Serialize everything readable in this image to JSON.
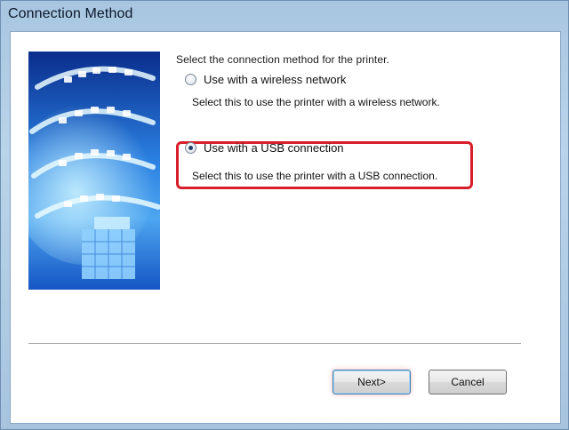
{
  "window": {
    "title": "Connection Method"
  },
  "prompt": "Select the connection method for the printer.",
  "options": [
    {
      "label": "Use with a wireless network",
      "description": "Select this to use the printer with a wireless network.",
      "selected": false
    },
    {
      "label": "Use with a USB connection",
      "description": "Select this to use the printer with a USB connection.",
      "selected": true
    }
  ],
  "buttons": {
    "next": "Next>",
    "cancel": "Cancel"
  },
  "colors": {
    "highlight": "#d81e2a",
    "titlebar": "#a9c6e1",
    "artwork_blue": "#1f5fb8"
  }
}
